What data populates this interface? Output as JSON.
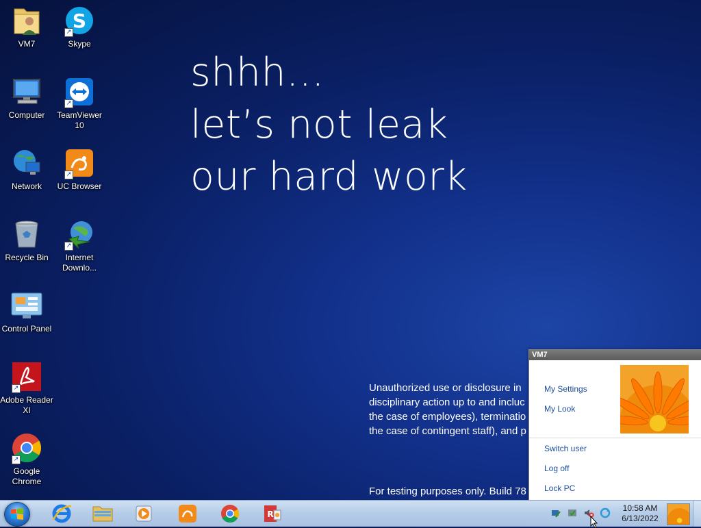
{
  "desktop_icons": [
    {
      "label": "VM7",
      "icon": "user-folder-icon"
    },
    {
      "label": "Skype",
      "icon": "skype-icon",
      "shortcut": true
    },
    {
      "label": "Computer",
      "icon": "computer-icon"
    },
    {
      "label": "TeamViewer 10",
      "icon": "teamviewer-icon",
      "shortcut": true
    },
    {
      "label": "Network",
      "icon": "network-icon"
    },
    {
      "label": "UC Browser",
      "icon": "uc-browser-icon",
      "shortcut": true
    },
    {
      "label": "Recycle Bin",
      "icon": "recycle-bin-icon"
    },
    {
      "label": "Internet Downlo...",
      "icon": "internet-download-manager-icon",
      "shortcut": true
    },
    {
      "label": "Control Panel",
      "icon": "control-panel-icon"
    },
    {
      "label": "Adobe Reader XI",
      "icon": "adobe-reader-icon",
      "shortcut": true
    },
    {
      "label": "Google Chrome",
      "icon": "chrome-icon",
      "shortcut": true
    }
  ],
  "wallpaper": {
    "lines": [
      "shhh...",
      "let’s not leak",
      "our hard work"
    ],
    "notice_lines": [
      "Unauthorized use or disclosure in",
      "disciplinary action up to and incluc",
      "the case of employees), terminatio",
      "the case of contingent staff), and p"
    ],
    "testing": "For testing purposes only. Build 78"
  },
  "user_panel": {
    "title": "VM7",
    "links": [
      "My Settings",
      "My Look"
    ],
    "actions": [
      "Switch user",
      "Log off",
      "Lock PC"
    ]
  },
  "taskbar": {
    "apps": [
      "internet-explorer-icon",
      "windows-explorer-icon",
      "media-player-icon",
      "uc-browser-icon",
      "chrome-icon",
      "reader-app-icon"
    ],
    "tray": [
      "network-tray-icon",
      "security-tray-icon",
      "volume-muted-icon",
      "sync-tray-icon"
    ],
    "time": "10:58 AM",
    "date": "6/13/2022"
  },
  "colors": {
    "desktop_bg": "#0a1f63",
    "link": "#1c4d9c",
    "taskbar": "#b6cde8"
  }
}
